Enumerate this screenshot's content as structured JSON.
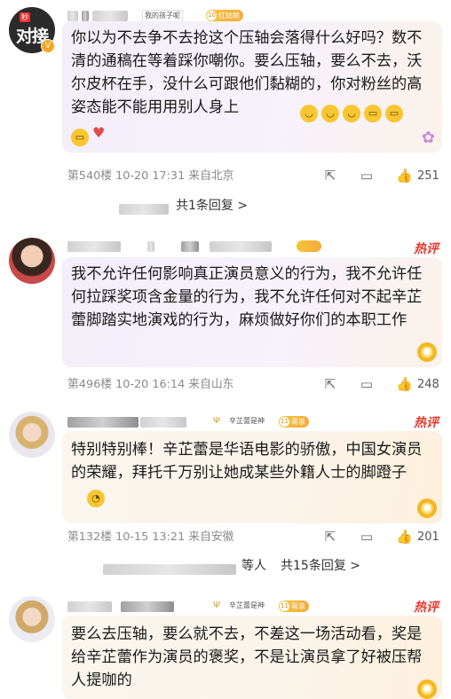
{
  "comments": [
    {
      "avatar_text_small": "秒",
      "avatar_text_big": "对接",
      "fan_badge": "我的孩子呢",
      "level": "10",
      "level_label": "红姑娘",
      "text": "你以为不去争不去抢这个压轴会落得什么好吗？数不清的通稿在等着踩你嘲你。要么压轴，要么不去，沃尔皮杯在手，没什么可跟他们黏糊的，你对粉丝的高姿态能不能用用别人身上",
      "meta": "第540楼  10-20 17:31  来自北京",
      "likes": "251",
      "replies": "共1条回复 >"
    },
    {
      "level_label": "",
      "hot": "热评",
      "text": "我不允许任何影响真正演员意义的行为，我不允许任何拉踩奖项含金量的行为，我不允许任何对不起辛芷蕾脚踏实地演戏的行为，麻烦做好你们的本职工作",
      "meta": "第496楼  10-20 16:14  来自山东",
      "likes": "248"
    },
    {
      "fan_badge": "辛芷蕾是神",
      "level": "11",
      "level_label": "蒋浪",
      "hot": "热评",
      "text": "特别特别棒！辛芷蕾是华语电影的骄傲，中国女演员的荣耀，拜托千万别让她成某些外籍人士的脚蹬子",
      "meta": "第132楼  10-15 13:21  来自安徽",
      "likes": "201",
      "replies_prefix": "等人",
      "replies": "共15条回复 >"
    },
    {
      "fan_badge": "辛芷蕾是神",
      "level": "11",
      "level_label": "蒋浪",
      "hot": "热评",
      "text": "要么去压轴，要么就不去，不差这一场活动看，奖是给辛芷蕾作为演员的褒奖，不是让演员拿了好被压帮人提咖的"
    }
  ],
  "icons": {
    "share": "share-icon",
    "comment": "comment-icon",
    "like": "like-icon",
    "cup": "cup-icon"
  },
  "colors": {
    "hot": "#e8392d",
    "badge": "#f5c438"
  }
}
